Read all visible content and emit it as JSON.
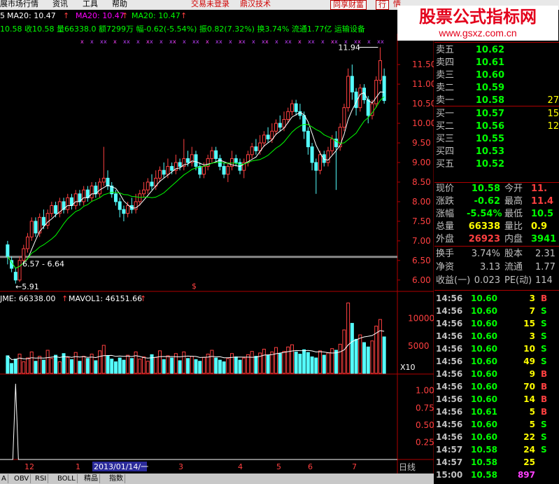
{
  "menu": {
    "items": [
      "展市场行情",
      "资讯",
      "工具",
      "帮助"
    ],
    "status_login": "交易未登录",
    "status_brand": "鼎汉技术",
    "btn_share": "同享财富",
    "btn_trade": "行",
    "btn_clipped": "情"
  },
  "logo": {
    "title": "股票公式指标网",
    "url": "www.gsxz.com.cn"
  },
  "ma_line": {
    "prefix": "5",
    "ma_a": "MA20: 10.47",
    "ma_b": "MA20: 10.47",
    "ma_c": "MA20: 10.47",
    "colors": {
      "ma_a": "#ffffff",
      "ma_b": "#ff00ff",
      "ma_c": "#00ff00"
    }
  },
  "summary_line": {
    "part1": "10.58 收10.58 量66338.0 额7299万",
    "part2": "幅-0.62(-5.54%)",
    "part3": "振0.82(7.32%) 换3.74% 流通1.77亿 运输设备"
  },
  "chart_labels": {
    "high_label": "11.94",
    "low_label": "5.91",
    "band_label": "6.57 - 6.64",
    "dollar_marker": "$",
    "volume_header": "JME: 66338.00",
    "mavol_header": "MAVOL1: 46151.66",
    "x10_label": "X10",
    "date_highlight": "2013/01/14/一",
    "day_mode": "日线"
  },
  "price_axis": [
    "11.50",
    "11.00",
    "10.50",
    "10.00",
    "9.50",
    "9.00",
    "8.50",
    "8.00",
    "7.50",
    "7.00",
    "6.50",
    "6.00"
  ],
  "volume_axis": [
    "10000",
    "5000"
  ],
  "indicator_axis": [
    "1.00",
    "0.75",
    "0.50",
    "0.25"
  ],
  "x_axis_labels": [
    "12",
    "1",
    "3",
    "4",
    "5",
    "6",
    "7"
  ],
  "order_book": {
    "sells": [
      {
        "label": "卖五",
        "price": "10.62",
        "volume": "",
        "price_color": "#00ff00"
      },
      {
        "label": "卖四",
        "price": "10.61",
        "volume": "",
        "price_color": "#00ff00"
      },
      {
        "label": "卖三",
        "price": "10.60",
        "volume": "",
        "price_color": "#00ff00"
      },
      {
        "label": "卖二",
        "price": "10.59",
        "volume": "",
        "price_color": "#00ff00"
      },
      {
        "label": "卖一",
        "price": "10.58",
        "volume": "27",
        "price_color": "#00ff00"
      }
    ],
    "buys": [
      {
        "label": "买一",
        "price": "10.57",
        "volume": "15",
        "price_color": "#00ff00"
      },
      {
        "label": "买二",
        "price": "10.56",
        "volume": "12",
        "price_color": "#00ff00"
      },
      {
        "label": "买三",
        "price": "10.55",
        "volume": "",
        "price_color": "#00ff00"
      },
      {
        "label": "买四",
        "price": "10.53",
        "volume": "",
        "price_color": "#00ff00"
      },
      {
        "label": "买五",
        "price": "10.52",
        "volume": "",
        "price_color": "#00ff00"
      }
    ]
  },
  "quote_panel": [
    {
      "l1": "现价",
      "v1": "10.58",
      "c1": "#00ff00",
      "l2": "今开",
      "v2": "11.",
      "c2": "#ff4040"
    },
    {
      "l1": "涨跌",
      "v1": "-0.62",
      "c1": "#00ff00",
      "l2": "最高",
      "v2": "11.4",
      "c2": "#ff4040"
    },
    {
      "l1": "涨幅",
      "v1": "-5.54%",
      "c1": "#00ff00",
      "l2": "最低",
      "v2": "10.5",
      "c2": "#00ff00"
    },
    {
      "l1": "总量",
      "v1": "66338",
      "c1": "#ffff00",
      "l2": "量比",
      "v2": "0.9",
      "c2": "#ffff00"
    },
    {
      "l1": "外盘",
      "v1": "26923",
      "c1": "#ff4040",
      "l2": "内盘",
      "v2": "3941",
      "c2": "#00ff00"
    }
  ],
  "fundamentals": [
    {
      "l1": "换手",
      "v1": "3.74%",
      "l2": "股本",
      "v2": "2.31"
    },
    {
      "l1": "净资",
      "v1": "3.13",
      "l2": "流通",
      "v2": "1.77"
    },
    {
      "l1": "收益(一)",
      "v1": "0.023",
      "l2": "PE(动)",
      "v2": "114"
    }
  ],
  "trades": [
    {
      "time": "14:56",
      "price": "10.60",
      "vol": "3",
      "side": "B"
    },
    {
      "time": "14:56",
      "price": "10.60",
      "vol": "7",
      "side": "S"
    },
    {
      "time": "14:56",
      "price": "10.60",
      "vol": "15",
      "side": "S"
    },
    {
      "time": "14:56",
      "price": "10.60",
      "vol": "3",
      "side": "S"
    },
    {
      "time": "14:56",
      "price": "10.60",
      "vol": "10",
      "side": "S"
    },
    {
      "time": "14:56",
      "price": "10.60",
      "vol": "49",
      "side": "S"
    },
    {
      "time": "14:56",
      "price": "10.60",
      "vol": "9",
      "side": "B"
    },
    {
      "time": "14:56",
      "price": "10.60",
      "vol": "70",
      "side": "B"
    },
    {
      "time": "14:56",
      "price": "10.60",
      "vol": "14",
      "side": "B"
    },
    {
      "time": "14:56",
      "price": "10.61",
      "vol": "5",
      "side": "B"
    },
    {
      "time": "14:56",
      "price": "10.60",
      "vol": "5",
      "side": "S"
    },
    {
      "time": "14:56",
      "price": "10.60",
      "vol": "22",
      "side": "S"
    },
    {
      "time": "14:57",
      "price": "10.58",
      "vol": "24",
      "side": "S"
    },
    {
      "time": "14:57",
      "price": "10.58",
      "vol": "25",
      "side": ""
    },
    {
      "time": "15:00",
      "price": "10.58",
      "vol": "897",
      "side": ""
    }
  ],
  "trade_colors": {
    "price": "#00ff00",
    "vol": "#ffff00",
    "B": "#ff4040",
    "S": "#00ff00",
    "last_vol": "#ff40ff"
  },
  "bottom_tabs": [
    "A",
    "OBV",
    "RSI",
    "BOLL",
    "精品",
    "指数"
  ],
  "chart_data": {
    "type": "candlestick",
    "title": "",
    "price_axis_range": [
      5.8,
      12.2
    ],
    "series": [
      {
        "name": "MA20",
        "color": "#ffffff"
      },
      {
        "name": "MA20",
        "color": "#00ff00"
      }
    ],
    "candles": [
      [
        6.9,
        6.6,
        7.0,
        6.4
      ],
      [
        6.5,
        6.3,
        6.6,
        6.2
      ],
      [
        6.2,
        6.0,
        6.3,
        5.91
      ],
      [
        6.0,
        6.5,
        6.6,
        5.95
      ],
      [
        6.5,
        6.8,
        6.9,
        6.4
      ],
      [
        6.8,
        7.1,
        7.2,
        6.7
      ],
      [
        7.1,
        7.5,
        7.6,
        7.0
      ],
      [
        7.5,
        7.2,
        7.6,
        7.1
      ],
      [
        7.2,
        7.6,
        7.7,
        7.1
      ],
      [
        7.6,
        7.4,
        7.8,
        7.3
      ],
      [
        7.4,
        7.7,
        7.8,
        7.3
      ],
      [
        7.7,
        7.9,
        8.0,
        7.6
      ],
      [
        7.9,
        7.7,
        8.0,
        7.6
      ],
      [
        7.7,
        8.0,
        8.1,
        7.6
      ],
      [
        8.0,
        7.8,
        8.1,
        7.7
      ],
      [
        7.8,
        8.1,
        8.2,
        7.7
      ],
      [
        8.1,
        7.9,
        8.2,
        7.8
      ],
      [
        7.9,
        8.2,
        8.3,
        7.8
      ],
      [
        8.2,
        8.0,
        8.3,
        7.9
      ],
      [
        8.0,
        8.3,
        8.4,
        7.9
      ],
      [
        8.3,
        8.1,
        8.4,
        8.0
      ],
      [
        8.1,
        8.4,
        8.5,
        8.0
      ],
      [
        8.4,
        8.2,
        8.5,
        8.1
      ],
      [
        8.2,
        8.5,
        8.6,
        8.1
      ],
      [
        8.5,
        8.6,
        9.4,
        8.4
      ],
      [
        8.6,
        8.4,
        8.8,
        8.3
      ],
      [
        8.4,
        8.2,
        8.5,
        8.1
      ],
      [
        8.2,
        8.0,
        8.3,
        7.9
      ],
      [
        8.0,
        7.8,
        8.1,
        7.6
      ],
      [
        7.8,
        7.7,
        7.9,
        7.5
      ],
      [
        7.7,
        7.9,
        8.0,
        7.6
      ],
      [
        7.9,
        7.8,
        8.1,
        7.7
      ],
      [
        7.8,
        8.0,
        8.2,
        7.7
      ],
      [
        8.0,
        8.2,
        8.3,
        7.9
      ],
      [
        8.2,
        8.3,
        8.5,
        8.1
      ],
      [
        8.3,
        8.5,
        8.6,
        8.2
      ],
      [
        8.5,
        8.4,
        8.7,
        8.3
      ],
      [
        8.4,
        8.6,
        8.8,
        8.3
      ],
      [
        8.6,
        8.8,
        8.9,
        8.5
      ],
      [
        8.8,
        8.7,
        9.0,
        8.6
      ],
      [
        8.7,
        8.9,
        9.1,
        8.6
      ],
      [
        8.9,
        8.8,
        9.0,
        8.7
      ],
      [
        8.8,
        9.0,
        9.2,
        8.7
      ],
      [
        9.0,
        8.9,
        9.1,
        8.8
      ],
      [
        8.9,
        9.1,
        9.6,
        8.8
      ],
      [
        9.1,
        9.0,
        9.3,
        8.9
      ],
      [
        9.0,
        9.2,
        9.4,
        8.9
      ],
      [
        9.2,
        8.9,
        9.3,
        8.8
      ],
      [
        8.9,
        8.7,
        9.0,
        8.6
      ],
      [
        8.7,
        8.9,
        9.0,
        8.6
      ],
      [
        8.9,
        9.1,
        9.2,
        8.8
      ],
      [
        9.1,
        9.3,
        9.4,
        9.0
      ],
      [
        9.3,
        9.1,
        9.4,
        9.0
      ],
      [
        9.1,
        8.9,
        9.2,
        8.8
      ],
      [
        8.9,
        8.7,
        9.0,
        8.6
      ],
      [
        8.7,
        8.9,
        9.0,
        8.5
      ],
      [
        8.9,
        9.1,
        9.3,
        8.8
      ],
      [
        9.1,
        9.0,
        9.2,
        8.9
      ],
      [
        9.0,
        8.8,
        9.1,
        8.7
      ],
      [
        8.8,
        9.0,
        9.1,
        8.6
      ],
      [
        9.0,
        9.2,
        9.3,
        8.9
      ],
      [
        9.2,
        9.4,
        9.5,
        9.1
      ],
      [
        9.4,
        9.3,
        9.6,
        9.2
      ],
      [
        9.3,
        9.5,
        9.7,
        9.2
      ],
      [
        9.5,
        9.7,
        9.8,
        9.4
      ],
      [
        9.7,
        9.6,
        9.9,
        9.5
      ],
      [
        9.6,
        9.8,
        10.0,
        9.5
      ],
      [
        9.8,
        10.0,
        10.1,
        9.7
      ],
      [
        10.0,
        9.9,
        10.2,
        9.8
      ],
      [
        9.9,
        10.1,
        10.3,
        9.8
      ],
      [
        10.1,
        10.3,
        10.4,
        10.0
      ],
      [
        10.3,
        10.5,
        10.6,
        10.2
      ],
      [
        10.5,
        10.3,
        10.6,
        10.2
      ],
      [
        10.3,
        10.2,
        10.5,
        10.1
      ],
      [
        10.2,
        9.8,
        10.3,
        9.6
      ],
      [
        9.8,
        9.4,
        9.9,
        9.2
      ],
      [
        9.4,
        9.0,
        9.5,
        8.8
      ],
      [
        9.0,
        8.8,
        9.1,
        8.2
      ],
      [
        8.8,
        9.2,
        9.3,
        8.7
      ],
      [
        9.2,
        9.0,
        9.3,
        8.9
      ],
      [
        9.0,
        9.3,
        9.4,
        8.9
      ],
      [
        9.3,
        9.6,
        9.7,
        9.2
      ],
      [
        9.6,
        9.4,
        9.8,
        8.3
      ],
      [
        9.4,
        9.9,
        10.0,
        9.3
      ],
      [
        9.9,
        10.4,
        10.5,
        9.8
      ],
      [
        10.4,
        11.2,
        11.4,
        10.3
      ],
      [
        11.2,
        10.8,
        11.5,
        10.6
      ],
      [
        10.8,
        10.4,
        10.9,
        10.2
      ],
      [
        10.4,
        10.9,
        11.0,
        10.3
      ],
      [
        10.9,
        10.6,
        11.0,
        10.5
      ],
      [
        10.6,
        10.2,
        10.7,
        10.0
      ],
      [
        10.2,
        10.5,
        10.6,
        10.1
      ],
      [
        10.5,
        11.1,
        11.2,
        10.4
      ],
      [
        11.1,
        11.6,
        11.94,
        11.0
      ],
      [
        11.2,
        10.58,
        11.4,
        10.5
      ]
    ],
    "volume_axis_range": [
      0,
      13000
    ],
    "volumes": [
      3200,
      1800,
      2600,
      3500,
      2100,
      2800,
      3900,
      2200,
      3100,
      2400,
      4200,
      2700,
      3300,
      2100,
      3600,
      2900,
      2500,
      3800,
      2200,
      3100,
      2700,
      3500,
      2300,
      4100,
      5100,
      3200,
      2600,
      2100,
      2800,
      2400,
      3300,
      2700,
      3900,
      2600,
      3000,
      2200,
      3400,
      2900,
      4100,
      2500,
      3200,
      2800,
      3600,
      2300,
      3900,
      2700,
      3100,
      2500,
      2200,
      2900,
      3500,
      4200,
      2800,
      2400,
      2100,
      2700,
      3600,
      3000,
      2400,
      2800,
      3400,
      4000,
      3100,
      3700,
      4400,
      3300,
      3900,
      4700,
      3600,
      4000,
      4800,
      5200,
      3900,
      3500,
      4300,
      3800,
      3000,
      2800,
      4100,
      3300,
      3700,
      4500,
      4200,
      5300,
      7900,
      12800,
      9100,
      6200,
      7000,
      5600,
      4800,
      5900,
      8600,
      9800,
      6634
    ],
    "vol_colors": "up=#ff4040 outline, down=#54ffff filled",
    "indicator_axis_range": [
      0,
      1.2
    ]
  }
}
